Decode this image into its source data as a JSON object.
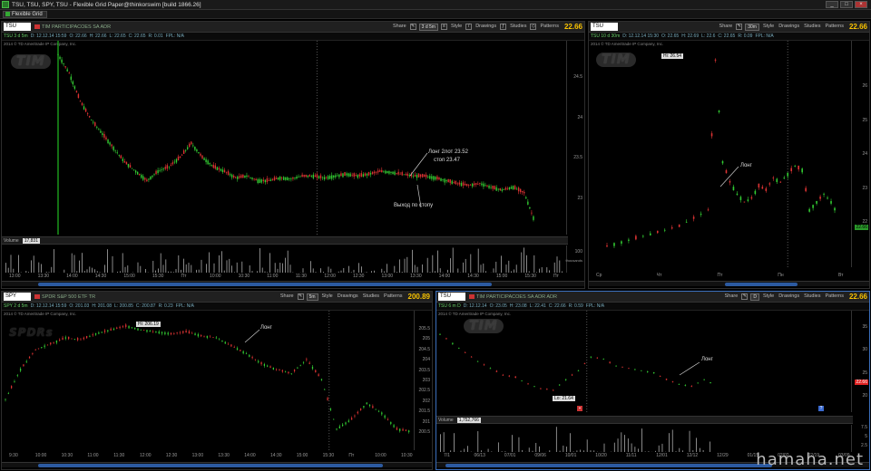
{
  "window": {
    "title": "TSU, TSU, SPY, TSU - Flexible Grid Paper@thinkorswim [build 1866.26]",
    "grid_tab": "Flexible Grid",
    "buttons": [
      "_",
      "□",
      "×"
    ]
  },
  "toolbar_common": {
    "share": "Share",
    "style": "Style",
    "drawings": "Drawings",
    "studies": "Studies",
    "patterns": "Patterns"
  },
  "panels": {
    "top_left": {
      "symbol": "TSU",
      "description": "TIM PARTICIPACOES SA ADR",
      "timeframe": "3 d 5m",
      "last_price": "22.66",
      "info": [
        "TSU 3 d 5m",
        "D: 12.12.14 15:59",
        "O: 22.66",
        "H: 22.66",
        "L: 22.65",
        "C: 22.65",
        "R: 0.01",
        "FPL: N/A"
      ],
      "subinfo": "2014 © TD Ameritrade IP Company, Inc.",
      "logo": "TIM",
      "y_ticks": [
        "24.5",
        "24",
        "23.5",
        "23"
      ],
      "volume_label": "Volume",
      "volume_value": "17,831",
      "volume_axis": [
        "100",
        "thousands"
      ],
      "x_ticks": [
        "13:00",
        "13:30",
        "14:00",
        "14:30",
        "15:00",
        "15:30",
        "Пт",
        "10:00",
        "10:30",
        "11:00",
        "11:30",
        "12:00",
        "12:30",
        "13:00",
        "13:30",
        "14:00",
        "14:30",
        "15:00",
        "15:30",
        "Пт"
      ],
      "annotations": [
        {
          "text": "Лонг 2лот 23.52"
        },
        {
          "text": "стоп 23.47"
        },
        {
          "text": "Выход по стопу"
        }
      ],
      "chart_data": {
        "type": "line",
        "title": "",
        "xlabel": "",
        "ylabel": "",
        "ylim": [
          22.95,
          24.85
        ],
        "x_index": [
          0,
          3,
          6,
          9,
          12,
          15,
          18,
          21,
          24,
          27,
          30,
          33,
          36,
          39,
          42,
          45,
          48,
          51,
          54,
          57,
          60,
          63,
          66,
          69,
          72,
          75,
          78,
          81,
          84,
          87,
          90,
          93,
          96,
          99,
          102,
          105,
          108,
          111,
          114,
          117,
          120,
          123,
          126,
          129
        ],
        "values": [
          24.8,
          24.6,
          24.3,
          24.1,
          23.95,
          23.8,
          23.65,
          23.55,
          23.45,
          23.55,
          23.6,
          23.7,
          23.85,
          23.7,
          23.6,
          23.55,
          23.48,
          23.5,
          23.45,
          23.45,
          23.48,
          23.47,
          23.5,
          23.5,
          23.48,
          23.5,
          23.52,
          23.5,
          23.52,
          23.55,
          23.54,
          23.52,
          23.5,
          23.5,
          23.48,
          23.45,
          23.42,
          23.4,
          23.42,
          23.38,
          23.35,
          23.38,
          23.32,
          23.0
        ]
      }
    },
    "top_right": {
      "symbol": "TSU",
      "timeframe": "10 d 30m",
      "last_price": "22.66",
      "tf_button": "30m",
      "info": [
        "TSU 10 d 30m",
        "D: 12.12.14 15:30",
        "O: 22.65",
        "H: 22.69",
        "L: 22.6",
        "C: 22.65",
        "R: 0.09",
        "FPL: N/A"
      ],
      "subinfo": "2014 © TD Ameritrade IP Company, Inc.",
      "logo": "TIM",
      "hi_label": "Hi: 26.54",
      "y_ticks": [
        "26",
        "25",
        "24",
        "23",
        "22"
      ],
      "current_price_box": "22.66",
      "x_ticks": [
        "Ср",
        "Чт",
        "Пт",
        "Пн",
        "Вт"
      ],
      "annotations": [
        {
          "text": "Лонг"
        }
      ],
      "chart_data": {
        "type": "line",
        "title": "",
        "ylim": [
          21.6,
          26.8
        ],
        "x_index": [
          0,
          4,
          8,
          12,
          16,
          20,
          24,
          28,
          30,
          32,
          34,
          36,
          38,
          40,
          42,
          44,
          46,
          48,
          50,
          52,
          54,
          56,
          58,
          60,
          62,
          64
        ],
        "values": [
          21.9,
          22.0,
          22.1,
          22.2,
          22.3,
          22.4,
          22.6,
          22.8,
          26.54,
          24.0,
          23.5,
          23.2,
          23.0,
          23.1,
          23.4,
          23.3,
          23.6,
          23.5,
          23.7,
          23.9,
          23.8,
          22.8,
          23.0,
          23.2,
          23.0,
          22.66
        ]
      }
    },
    "bottom_left": {
      "symbol": "SPY",
      "description": "SPDR S&P 500 ETF TR",
      "timeframe": "2 d 5m",
      "last_price": "200.89",
      "tf_button": "5m",
      "info": [
        "SPY 2 d 5m",
        "D: 12.12.14 15:59",
        "O: 201.03",
        "H: 201.08",
        "L: 200.85",
        "C: 200.87",
        "R: 0.23",
        "FPL: N/A"
      ],
      "subinfo": "2014 © TD Ameritrade IP Company, Inc.",
      "logo": "SPDRs",
      "hi_label": "Hi: 206.19",
      "y_ticks": [
        "205.5",
        "205",
        "204.5",
        "204",
        "203.5",
        "203",
        "202.5",
        "202",
        "201.5",
        "201",
        "200.5"
      ],
      "x_ticks": [
        "9:30",
        "10:00",
        "10:30",
        "11:00",
        "11:30",
        "12:00",
        "12:30",
        "13:00",
        "13:30",
        "14:00",
        "14:30",
        "15:00",
        "15:30",
        "Пт",
        "10:00",
        "10:30"
      ],
      "annotations": [
        {
          "text": "Лонг"
        }
      ],
      "chart_data": {
        "type": "line",
        "title": "",
        "ylim": [
          200.3,
          206.6
        ],
        "x_index": [
          0,
          4,
          8,
          12,
          16,
          20,
          24,
          28,
          32,
          36,
          40,
          44,
          48,
          52,
          56,
          60,
          64,
          68,
          72,
          76,
          80,
          84,
          88,
          92,
          96,
          100,
          104,
          108
        ],
        "values": [
          202.5,
          204.0,
          205.0,
          205.3,
          205.6,
          205.5,
          205.8,
          206.0,
          206.19,
          206.0,
          205.9,
          205.8,
          205.9,
          205.7,
          205.6,
          205.2,
          204.8,
          204.3,
          204.0,
          203.8,
          204.5,
          203.5,
          201.0,
          201.5,
          202.3,
          201.8,
          201.0,
          200.87
        ]
      }
    },
    "bottom_right": {
      "symbol": "TSU",
      "description": "TIM PARTICIPACOES SA ADR ADR",
      "timeframe": "6 m D",
      "last_price": "22.66",
      "tf_button": "D",
      "info": [
        "TSU 6 m D",
        "D: 12.12.14",
        "O: 23.05",
        "H: 23.08",
        "L: 22.41",
        "C: 22.66",
        "R: 0.59",
        "FPL: N/A"
      ],
      "subinfo": "2014 © TD Ameritrade IP Company, Inc.",
      "logo": "TIM",
      "lo_label": "Lo: 21.64",
      "y_ticks": [
        "35",
        "30",
        "25",
        "20"
      ],
      "current_price_box": "22.66",
      "volume_label": "Volume",
      "volume_value": "1,752,766",
      "volume_axis": [
        "7.5",
        "5",
        "2.5"
      ],
      "x_ticks": [
        "7/1",
        "06/13",
        "07/01",
        "09/06",
        "10/01",
        "10/20",
        "11/11",
        "12/01",
        "12/12",
        "12/29",
        "01/15",
        "02/02",
        "02/19",
        "03/09"
      ],
      "annotations": [
        {
          "text": "Лонг"
        }
      ],
      "chart_data": {
        "type": "line",
        "title": "",
        "ylim": [
          18,
          38
        ],
        "x_index": [
          0,
          6,
          12,
          18,
          24,
          30,
          36,
          42,
          48,
          54,
          60,
          66,
          72,
          78,
          84,
          90,
          96,
          102,
          108,
          114,
          120,
          126,
          132
        ],
        "values": [
          34,
          32,
          30,
          28,
          26.5,
          25,
          24.5,
          23,
          22,
          21.64,
          24,
          26,
          29,
          28.5,
          27,
          26.5,
          26,
          25.5,
          24,
          23,
          22.5,
          24,
          22.66
        ]
      }
    }
  },
  "watermark": "hamaha.net"
}
